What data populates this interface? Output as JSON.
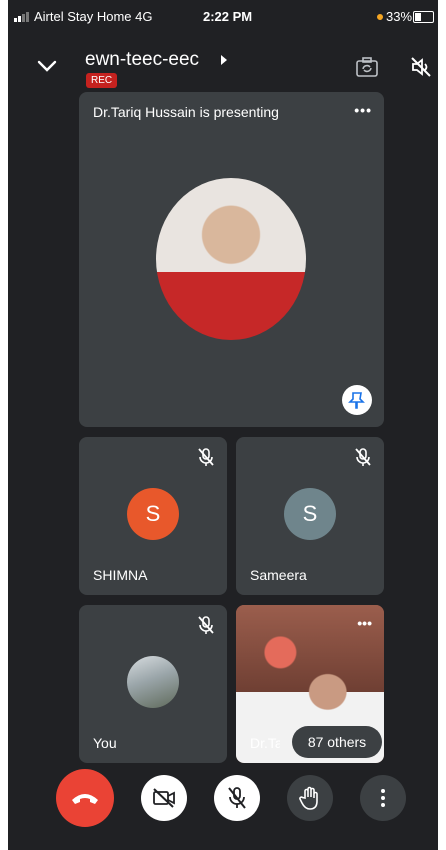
{
  "status_bar": {
    "carrier": "Airtel Stay Home  4G",
    "time": "2:22 PM",
    "battery": "33%"
  },
  "header": {
    "title": "ewn-teec-eec",
    "rec_label": "REC"
  },
  "presenting": {
    "label": "Dr.Tariq Hussain is presenting"
  },
  "participants": [
    {
      "name": "SHIMNA",
      "initial": "S",
      "color": "#e8582b"
    },
    {
      "name": "Sameera",
      "initial": "S",
      "color": "#6f858c"
    },
    {
      "name": "You"
    },
    {
      "name": "Dr.Tariq Hussain"
    }
  ],
  "others_label": "87 others",
  "icons": {
    "header": [
      "chevron-down-icon",
      "play-arrow-icon",
      "camera-switch-icon",
      "speaker-off-icon"
    ],
    "controls": [
      "end-call-icon",
      "camera-off-icon",
      "mic-off-icon",
      "raise-hand-icon",
      "more-vert-icon"
    ]
  }
}
